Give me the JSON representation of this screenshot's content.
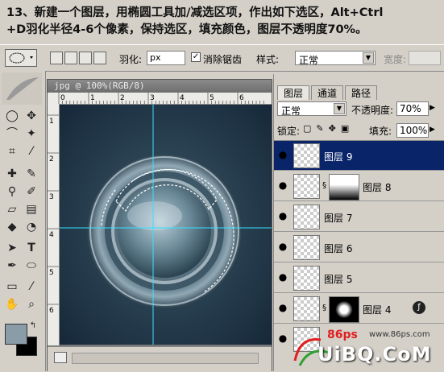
{
  "instruction": {
    "line1": "13、新建一个图层，用椭圆工具加/减选区项，作出如下选区，Alt+Ctrl",
    "line2": "+D羽化半径4-6个像素，保持选区，填充颜色，图层不透明度70%。"
  },
  "options_bar": {
    "feather_label": "羽化:",
    "feather_value": "px",
    "antialias_label": "消除锯齿",
    "antialias_checked": "✓",
    "style_label": "样式:",
    "style_value": "正常",
    "width_label": "宽度:"
  },
  "document": {
    "title": "jpg @ 100%(RGB/8)",
    "ruler_h_ticks": [
      "0",
      "1",
      "2",
      "3",
      "4",
      "5",
      "6"
    ],
    "ruler_v_ticks": [
      "1",
      "2",
      "3",
      "4",
      "5",
      "6"
    ]
  },
  "layers_panel": {
    "tabs": [
      "图层",
      "通道",
      "路径"
    ],
    "blend_mode": "正常",
    "opacity_label": "不透明度:",
    "opacity_value": "70%",
    "lock_label": "锁定:",
    "fill_label": "填充:",
    "fill_value": "100%",
    "layers": [
      {
        "name": "图层 9",
        "selected": true
      },
      {
        "name": "图层 8",
        "selected": false
      },
      {
        "name": "图层 7",
        "selected": false
      },
      {
        "name": "图层 6",
        "selected": false
      },
      {
        "name": "图层 5",
        "selected": false
      },
      {
        "name": "图层 4",
        "selected": false
      }
    ]
  },
  "watermark": {
    "site1": "86ps",
    "site2": "www.86ps.com",
    "brand": "UiBQ.CoM"
  },
  "colors": {
    "ui_gray": "#d4d0c8",
    "selection_blue": "#0a246a",
    "canvas_dark": "#1e3442",
    "guide_cyan": "#36e0ff",
    "fg_swatch": "#8a9ca8"
  }
}
